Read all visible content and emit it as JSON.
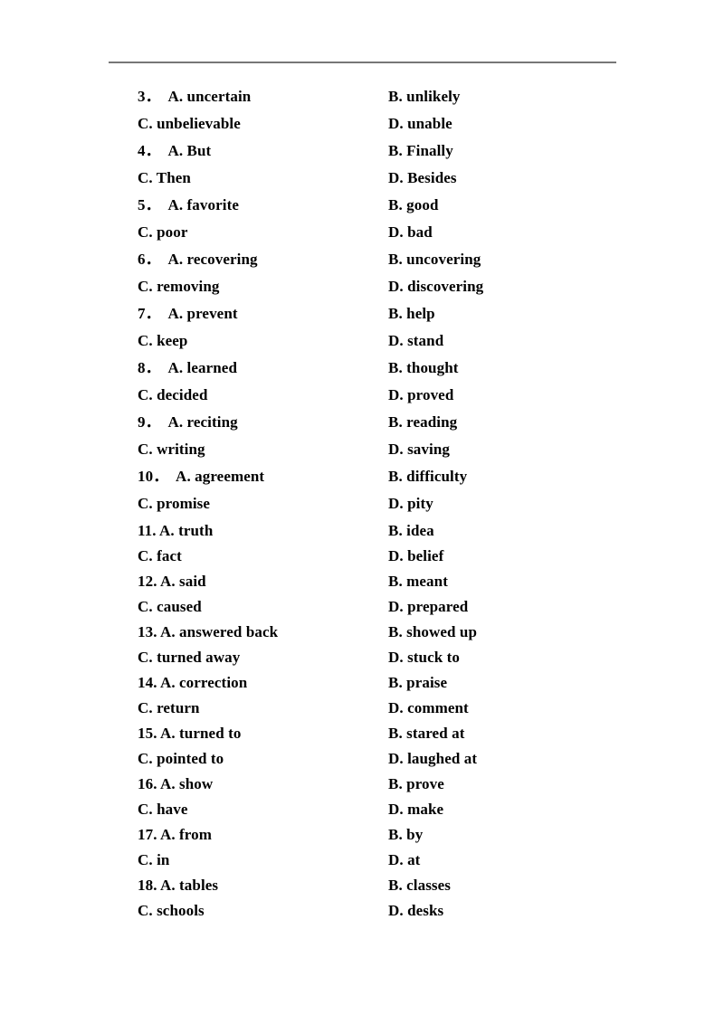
{
  "document": {
    "background_color": "#ffffff",
    "text_color": "#000000",
    "rule_color": "#767676"
  },
  "rows": [
    {
      "left": "3．  A. uncertain",
      "right": "B. unlikely",
      "spacing": "normal"
    },
    {
      "left": "C. unbelievable",
      "right": "D. unable",
      "spacing": "normal"
    },
    {
      "left": "4．  A. But",
      "right": "B. Finally",
      "spacing": "normal"
    },
    {
      "left": "C. Then",
      "right": "D. Besides",
      "spacing": "normal"
    },
    {
      "left": "5．  A. favorite",
      "right": "B. good",
      "spacing": "normal"
    },
    {
      "left": "C. poor",
      "right": "D. bad",
      "spacing": "normal"
    },
    {
      "left": "6．  A. recovering",
      "right": "B. uncovering",
      "spacing": "normal"
    },
    {
      "left": "C. removing",
      "right": "D. discovering",
      "spacing": "normal"
    },
    {
      "left": "7．  A. prevent",
      "right": "B. help",
      "spacing": "normal"
    },
    {
      "left": "C. keep",
      "right": "D. stand",
      "spacing": "normal"
    },
    {
      "left": "8．  A. learned",
      "right": "B. thought",
      "spacing": "normal"
    },
    {
      "left": "C. decided",
      "right": "D. proved",
      "spacing": "normal"
    },
    {
      "left": "9．  A. reciting",
      "right": "B. reading",
      "spacing": "normal"
    },
    {
      "left": "C. writing",
      "right": "D. saving",
      "spacing": "normal"
    },
    {
      "left": "10．  A. agreement",
      "right": "B. difficulty",
      "spacing": "normal"
    },
    {
      "left": "C. promise",
      "right": "D. pity",
      "spacing": "normal"
    },
    {
      "left": "11. A. truth",
      "right": "B. idea",
      "spacing": "tight"
    },
    {
      "left": "C. fact",
      "right": "D. belief",
      "spacing": "tight"
    },
    {
      "left": "12. A. said",
      "right": "B. meant",
      "spacing": "tight"
    },
    {
      "left": "C. caused",
      "right": "D. prepared",
      "spacing": "tight"
    },
    {
      "left": "13. A. answered back",
      "right": "B. showed up",
      "spacing": "tight"
    },
    {
      "left": "C. turned away",
      "right": "D. stuck to",
      "spacing": "tight"
    },
    {
      "left": "14. A. correction",
      "right": "B. praise",
      "spacing": "tight"
    },
    {
      "left": "C. return",
      "right": "D. comment",
      "spacing": "tight"
    },
    {
      "left": "15. A. turned to",
      "right": "B. stared at",
      "spacing": "tight"
    },
    {
      "left": "C. pointed to",
      "right": "D. laughed at",
      "spacing": "tight"
    },
    {
      "left": "16. A. show",
      "right": "B. prove",
      "spacing": "tight"
    },
    {
      "left": "C. have",
      "right": "D. make",
      "spacing": "tight"
    },
    {
      "left": "17. A. from",
      "right": "B. by",
      "spacing": "tight"
    },
    {
      "left": "C. in",
      "right": "D. at",
      "spacing": "tight"
    },
    {
      "left": "18. A. tables",
      "right": "B. classes",
      "spacing": "tight"
    },
    {
      "left": "C. schools",
      "right": "D. desks",
      "spacing": "tight"
    }
  ]
}
